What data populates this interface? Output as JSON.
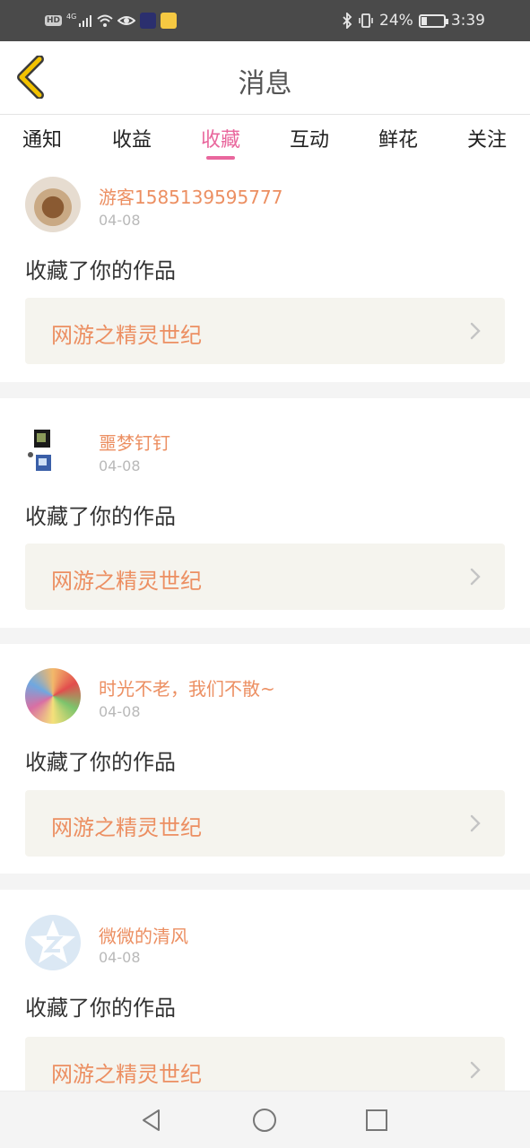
{
  "status_bar": {
    "left_icons": [
      "hd-icon",
      "signal-4g-icon",
      "wifi-icon",
      "eye-icon",
      "app-icon",
      "weibo-icon"
    ],
    "hd": "HD",
    "network": "4G",
    "battery": "24%",
    "battery_level": 0.24,
    "time": "3:39"
  },
  "header": {
    "title": "消息",
    "back_icon": "chevron-left-icon"
  },
  "tabs": [
    {
      "label": "通知"
    },
    {
      "label": "收益"
    },
    {
      "label": "收藏",
      "active": true
    },
    {
      "label": "互动"
    },
    {
      "label": "鲜花"
    },
    {
      "label": "关注"
    }
  ],
  "items": [
    {
      "user": "游客1585139595777",
      "date": "04-08",
      "message": "收藏了你的作品",
      "work": "网游之精灵世纪",
      "avatar": "avatar-photo"
    },
    {
      "user": "噩梦钉钉",
      "date": "04-08",
      "message": "收藏了你的作品",
      "work": "网游之精灵世纪",
      "avatar": "avatar-photo"
    },
    {
      "user": "时光不老，我们不散~",
      "date": "04-08",
      "message": "收藏了你的作品",
      "work": "网游之精灵世纪",
      "avatar": "avatar-photo"
    },
    {
      "user": "微微的清风",
      "date": "04-08",
      "message": "收藏了你的作品",
      "work": "网游之精灵世纪",
      "avatar": "default-avatar-icon"
    }
  ],
  "colors": {
    "accent_pink": "#e9679d",
    "name_orange": "#ec8f62",
    "back_yellow": "#f2c200",
    "work_bg": "#f5f4ee"
  },
  "nav_bar": [
    "back-triangle-icon",
    "home-circle-icon",
    "recents-square-icon"
  ]
}
